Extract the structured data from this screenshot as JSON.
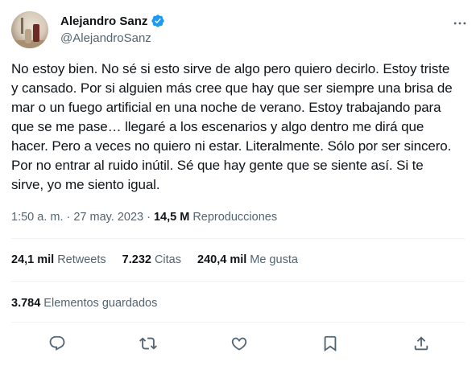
{
  "author": {
    "display_name": "Alejandro Sanz",
    "handle": "@AlejandroSanz",
    "verified": true,
    "avatar_icon": "profile-photo"
  },
  "tweet": {
    "text": "No estoy bien. No sé si esto sirve de algo pero quiero decirlo. Estoy triste\ny cansado. Por si alguien más cree que hay que ser siempre una brisa de\nmar o un fuego artificial en una noche de verano. Estoy trabajando para\nque se me pase… llegaré a los escenarios y algo dentro me dirá que\nhacer. Pero a veces no quiero ni estar. Literalmente. Sólo por ser sincero.\nPor no entrar al ruido inútil. Sé que hay gente que se siente así. Si te\nsirve, yo me siento igual.",
    "time": "1:50 a. m.",
    "separator": "·",
    "date": "27 may. 2023",
    "views_count": "14,5 M",
    "views_label": "Reproducciones"
  },
  "stats": {
    "retweets_count": "24,1 mil",
    "retweets_label": "Retweets",
    "quotes_count": "7.232",
    "quotes_label": "Citas",
    "likes_count": "240,4 mil",
    "likes_label": "Me gusta",
    "bookmarks_count": "3.784",
    "bookmarks_label": "Elementos guardados"
  },
  "actions": [
    "reply-icon",
    "retweet-icon",
    "like-icon",
    "bookmark-icon",
    "share-icon"
  ],
  "colors": {
    "text_primary": "#0f1419",
    "text_secondary": "#536471",
    "verified_blue": "#1d9bf0",
    "divider": "#eff3f4"
  }
}
